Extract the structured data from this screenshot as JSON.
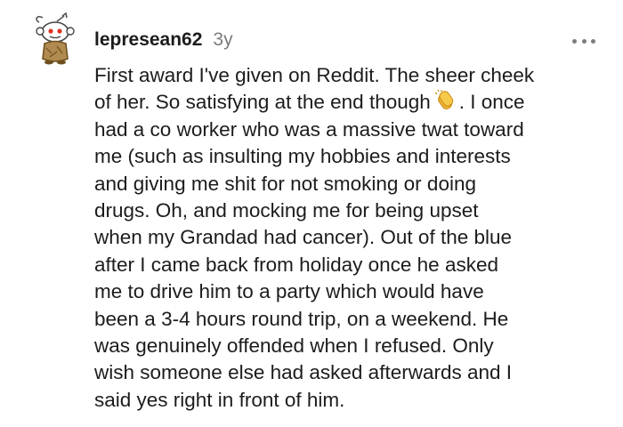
{
  "comment": {
    "username": "lepresean62",
    "age": "3y",
    "avatar_icon": "snoo-avatar-icon",
    "more_icon": "more-options-icon",
    "emoji_icon": "clapping-hands-icon",
    "lines_before_emoji": [
      "First award I've given on Reddit. The sheer cheek",
      "of her. So satisfying at the end though"
    ],
    "emoji_line_tail": ". I once",
    "lines_after_emoji": [
      "had a co worker who was a massive twat toward",
      "me (such as insulting my hobbies and interests",
      "and giving me shit for not smoking or doing",
      "drugs. Oh, and mocking me for being upset",
      "when my Grandad had cancer). Out of the blue",
      "after I came back from holiday once he asked",
      "me to drive him to a party which would have",
      "been a 3-4 hours round trip, on a weekend. He",
      "was genuinely offended when I refused. Only",
      "wish someone else had asked afterwards and I",
      "said yes right in front of him."
    ]
  },
  "colors": {
    "text": "#1c1c1c",
    "meta": "#7c7c7c",
    "background": "#ffffff",
    "emoji": "#f2b533"
  }
}
